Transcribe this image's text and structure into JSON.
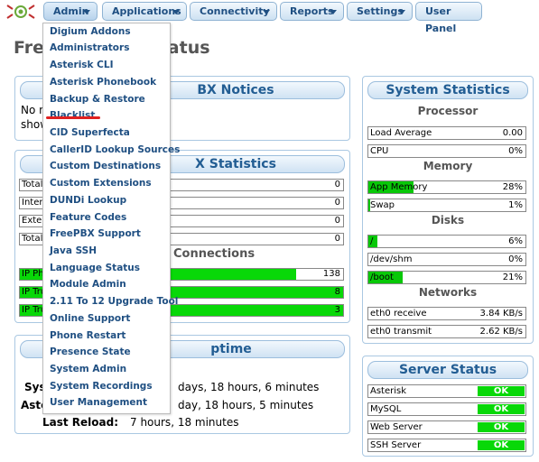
{
  "nav": {
    "items": [
      {
        "label": "Admin",
        "dropdown": true,
        "active": true
      },
      {
        "label": "Applications",
        "dropdown": true
      },
      {
        "label": "Connectivity",
        "dropdown": true
      },
      {
        "label": "Reports",
        "dropdown": true
      },
      {
        "label": "Settings",
        "dropdown": true
      },
      {
        "label": "User Panel",
        "dropdown": false
      }
    ]
  },
  "page_title": "Fre",
  "page_title_tail": "Status",
  "admin_menu": {
    "items": [
      "Digium Addons",
      "Administrators",
      "Asterisk CLI",
      "Asterisk Phonebook",
      "Backup & Restore",
      "Blacklist",
      "CID Superfecta",
      "CallerID Lookup Sources",
      "Custom Destinations",
      "Custom Extensions",
      "DUNDi Lookup",
      "Feature Codes",
      "FreePBX Support",
      "Java SSH",
      "Language Status",
      "Module Admin",
      "2.11 To 12 Upgrade Tool",
      "Online Support",
      "Phone Restart",
      "Presence State",
      "System Admin",
      "System Recordings",
      "User Management"
    ],
    "highlighted": "Blacklist"
  },
  "notices": {
    "title_tail": "BX Notices",
    "text_line1": "No n",
    "text_line2": "show"
  },
  "pbx_stats": {
    "title_tail": "X Statistics",
    "rows": [
      {
        "label": "Total",
        "value": "0"
      },
      {
        "label": "Intern",
        "value": "0"
      },
      {
        "label": "Exter",
        "value": "0"
      },
      {
        "label": "Total",
        "value": "0"
      }
    ],
    "connections_title": "Connections",
    "connection_rows": [
      {
        "label": "IP Ph",
        "value": "138",
        "fill": 0.82
      },
      {
        "label": "IP Tru",
        "value": "8",
        "fill": 1.0
      },
      {
        "label": "IP Tru",
        "value": "3",
        "fill": 1.0
      }
    ]
  },
  "uptime": {
    "title_tail": "ptime",
    "system_label": "Sys",
    "system_value": "days, 18 hours, 6 minutes",
    "asterisk_label": "Aste",
    "asterisk_value": "day, 18 hours, 5 minutes",
    "reload_label": "Last Reload:",
    "reload_value": "7 hours, 18 minutes"
  },
  "system_stats": {
    "title": "System Statistics",
    "processor_title": "Processor",
    "processor": [
      {
        "label": "Load Average",
        "value": "0.00",
        "fill": 0
      },
      {
        "label": "CPU",
        "value": "0%",
        "fill": 0
      }
    ],
    "memory_title": "Memory",
    "memory": [
      {
        "label": "App Memory",
        "value": "28%",
        "fill": 0.28
      },
      {
        "label": "Swap",
        "value": "1%",
        "fill": 0.01
      }
    ],
    "disks_title": "Disks",
    "disks": [
      {
        "label": "/",
        "value": "6%",
        "fill": 0.06
      },
      {
        "label": "/dev/shm",
        "value": "0%",
        "fill": 0
      },
      {
        "label": "/boot",
        "value": "21%",
        "fill": 0.21
      }
    ],
    "networks_title": "Networks",
    "networks": [
      {
        "label": "eth0 receive",
        "value": "3.84 KB/s",
        "fill": 0
      },
      {
        "label": "eth0 transmit",
        "value": "2.62 KB/s",
        "fill": 0
      }
    ]
  },
  "server_status": {
    "title": "Server Status",
    "rows": [
      {
        "label": "Asterisk",
        "status": "OK"
      },
      {
        "label": "MySQL",
        "status": "OK"
      },
      {
        "label": "Web Server",
        "status": "OK"
      },
      {
        "label": "SSH Server",
        "status": "OK"
      }
    ]
  },
  "colors": {
    "accent": "#225d93",
    "ok_green": "#08d808",
    "highlight_red": "#e02020"
  }
}
